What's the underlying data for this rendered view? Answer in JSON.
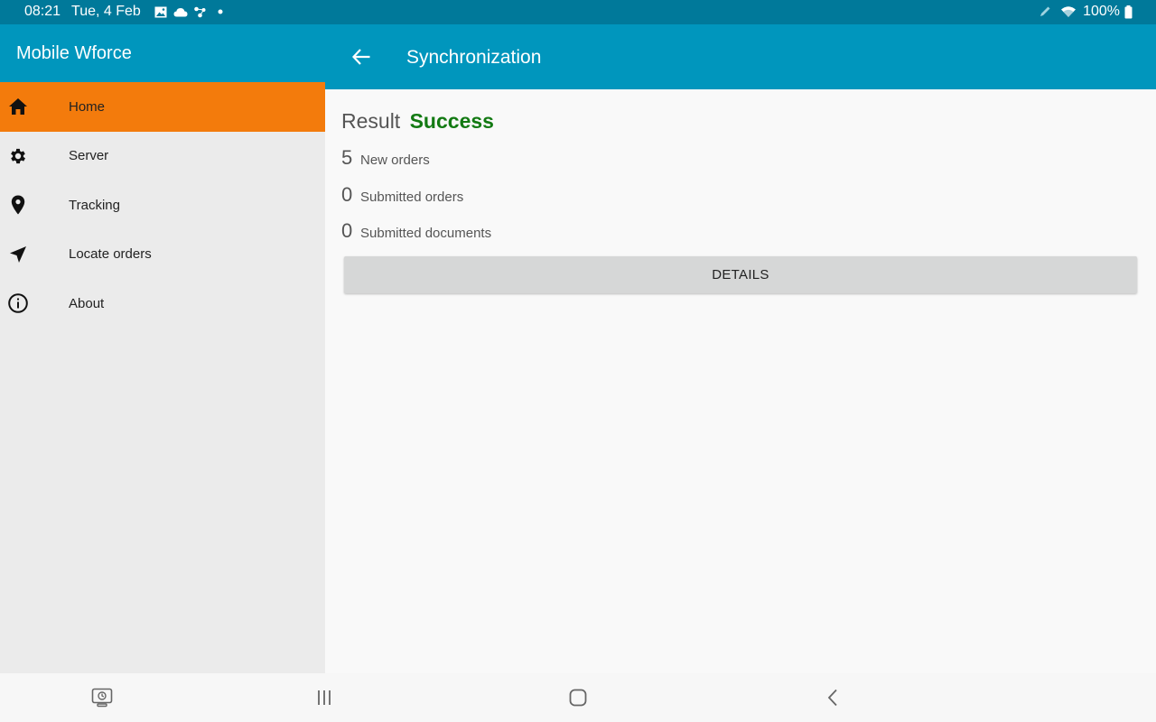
{
  "status_bar": {
    "time": "08:21",
    "date": "Tue, 4 Feb",
    "battery": "100%",
    "icons": [
      "gallery-icon",
      "cloud-icon",
      "connection-icon",
      "dot-icon",
      "pen-icon",
      "wifi-icon",
      "battery-icon"
    ]
  },
  "drawer": {
    "app_name": "Mobile Wforce",
    "items": [
      {
        "label": "Home",
        "icon": "home-icon",
        "active": true
      },
      {
        "label": "Server",
        "icon": "gear-icon",
        "active": false
      },
      {
        "label": "Tracking",
        "icon": "location-pin-icon",
        "active": false
      },
      {
        "label": "Locate orders",
        "icon": "navigation-arrow-icon",
        "active": false
      },
      {
        "label": "About",
        "icon": "info-icon",
        "active": false
      }
    ]
  },
  "appbar": {
    "title": "Synchronization",
    "back_icon": "arrow-back-icon"
  },
  "main": {
    "result_label": "Result",
    "result_value": "Success",
    "stats": [
      {
        "count": "5",
        "label": "New orders"
      },
      {
        "count": "0",
        "label": "Submitted orders"
      },
      {
        "count": "0",
        "label": "Submitted documents"
      }
    ],
    "details_label": "DETAILS"
  },
  "colors": {
    "status_bar": "#00799a",
    "primary": "#0096bd",
    "active_item": "#f37b0c",
    "success": "#137a13",
    "drawer_bg": "#ebebeb"
  },
  "navbar": {
    "icons": [
      "screen-recorder-icon",
      "recent-apps-icon",
      "home-circle-icon",
      "back-chevron-icon"
    ]
  }
}
